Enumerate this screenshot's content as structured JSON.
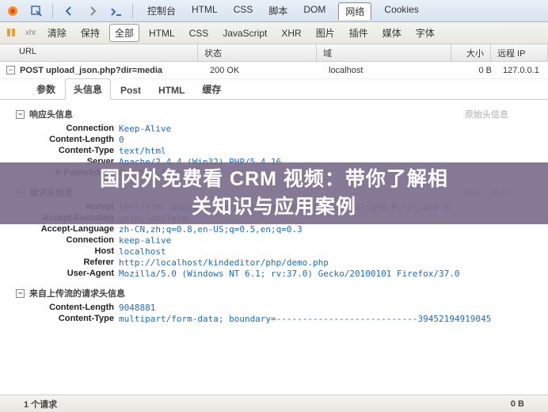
{
  "toolbar1": {
    "tabs": [
      "控制台",
      "HTML",
      "CSS",
      "脚本",
      "DOM",
      "网络",
      "Cookies"
    ],
    "active_index": 5
  },
  "toolbar2": {
    "xhr_label": "xhr",
    "buttons": [
      "清除",
      "保持",
      "全部",
      "HTML",
      "CSS",
      "JavaScript",
      "XHR",
      "图片",
      "插件",
      "媒体",
      "字体"
    ],
    "active_index": 2
  },
  "table": {
    "headers": {
      "url": "URL",
      "status": "状态",
      "domain": "域",
      "size": "大小",
      "ip": "远程 IP"
    },
    "row": {
      "method": "POST",
      "url": "upload_json.php?dir=media",
      "status": "200 OK",
      "domain": "localhost",
      "size": "0 B",
      "ip": "127.0.0.1"
    }
  },
  "detail_tabs": {
    "items": [
      "参数",
      "头信息",
      "Post",
      "HTML",
      "缓存"
    ],
    "active_index": 1
  },
  "sections": {
    "response": {
      "title": "响应头信息",
      "raw": "原始头信息",
      "rows": [
        {
          "k": "Connection",
          "v": "Keep-Alive"
        },
        {
          "k": "Content-Length",
          "v": "0"
        },
        {
          "k": "Content-Type",
          "v": "text/html"
        },
        {
          "k": "Server",
          "v": "Apache/2.4.4 (Win32) PHP/5.4.16"
        },
        {
          "k": "X-Powered-By",
          "v": "PHP/5.4.16"
        }
      ]
    },
    "request": {
      "title": "请求头信息",
      "raw": "原始头信息",
      "rows": [
        {
          "k": "Accept",
          "v": "text/html,application/xhtml+xml,application/xml;q=0.9,*/*;q=0.8"
        },
        {
          "k": "Accept-Encoding",
          "v": "gzip, deflate"
        },
        {
          "k": "Accept-Language",
          "v": "zh-CN,zh;q=0.8,en-US;q=0.5,en;q=0.3"
        },
        {
          "k": "Connection",
          "v": "keep-alive"
        },
        {
          "k": "Host",
          "v": "localhost"
        },
        {
          "k": "Referer",
          "v": "http://localhost/kindeditor/php/demo.php"
        },
        {
          "k": "User-Agent",
          "v": "Mozilla/5.0 (Windows NT 6.1; rv:37.0) Gecko/20100101 Firefox/37.0"
        }
      ]
    },
    "upstream": {
      "title": "来自上传流的请求头信息",
      "rows": [
        {
          "k": "Content-Length",
          "v": "9048881"
        },
        {
          "k": "Content-Type",
          "v": "multipart/form-data; boundary=---------------------------39452194919045"
        }
      ]
    }
  },
  "statusbar": {
    "left": "1 个请求",
    "right": "0 B"
  },
  "overlay": {
    "line1": "国内外免费看 CRM 视频：带你了解相",
    "line2": "关知识与应用案例"
  }
}
